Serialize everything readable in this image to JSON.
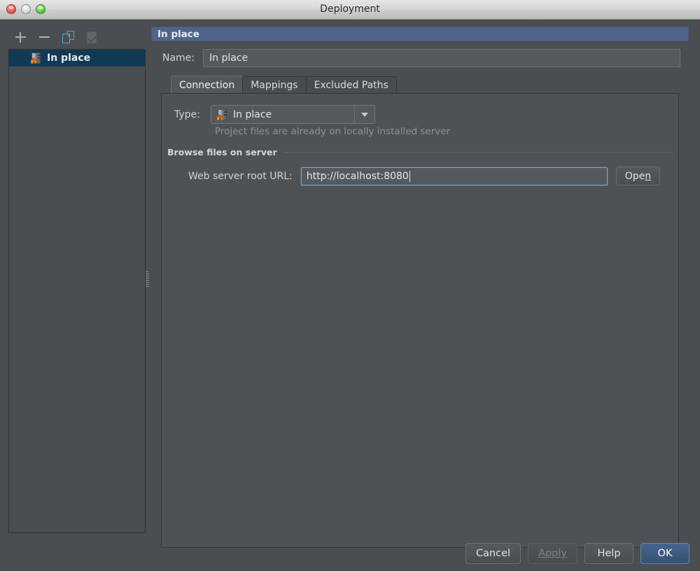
{
  "window": {
    "title": "Deployment",
    "traffic_lights": [
      "close-button",
      "minimize-button",
      "zoom-button"
    ]
  },
  "sidebar": {
    "toolbar": [
      {
        "name": "add-button",
        "icon": "plus-icon",
        "enabled": true
      },
      {
        "name": "remove-button",
        "icon": "minus-icon",
        "enabled": true
      },
      {
        "name": "copy-button",
        "icon": "copy-icon",
        "enabled": true
      },
      {
        "name": "set-default-button",
        "icon": "server-check-icon",
        "enabled": false
      }
    ],
    "items": [
      {
        "label": "In place",
        "icon": "in-place-server-icon",
        "selected": true
      }
    ]
  },
  "panel": {
    "header_title": "In place",
    "name_label": "Name:",
    "name_value": "In place",
    "tabs": [
      {
        "label": "Connection",
        "active": true
      },
      {
        "label": "Mappings",
        "active": false
      },
      {
        "label": "Excluded Paths",
        "active": false
      }
    ],
    "connection": {
      "type_label": "Type:",
      "type_value": "In place",
      "type_icon": "in-place-server-icon",
      "type_hint": "Project files are already on locally installed server",
      "group_title": "Browse files on server",
      "url_label": "Web server root URL:",
      "url_value": "http://localhost:8080",
      "open_button": {
        "prefix": "Ope",
        "mnemonic": "n",
        "suffix": ""
      }
    }
  },
  "footer": {
    "buttons": [
      {
        "label": "Cancel",
        "state": "normal"
      },
      {
        "label": "Apply",
        "state": "disabled",
        "mnemonic": "A"
      },
      {
        "label": "Help",
        "state": "normal"
      },
      {
        "label": "OK",
        "state": "primary"
      }
    ]
  },
  "colors": {
    "background": "#4a4e51",
    "panel_header": "#4e6488",
    "selection": "#103a56",
    "primary_button": "#3e5a80",
    "focus_border": "#6fa8d6"
  }
}
